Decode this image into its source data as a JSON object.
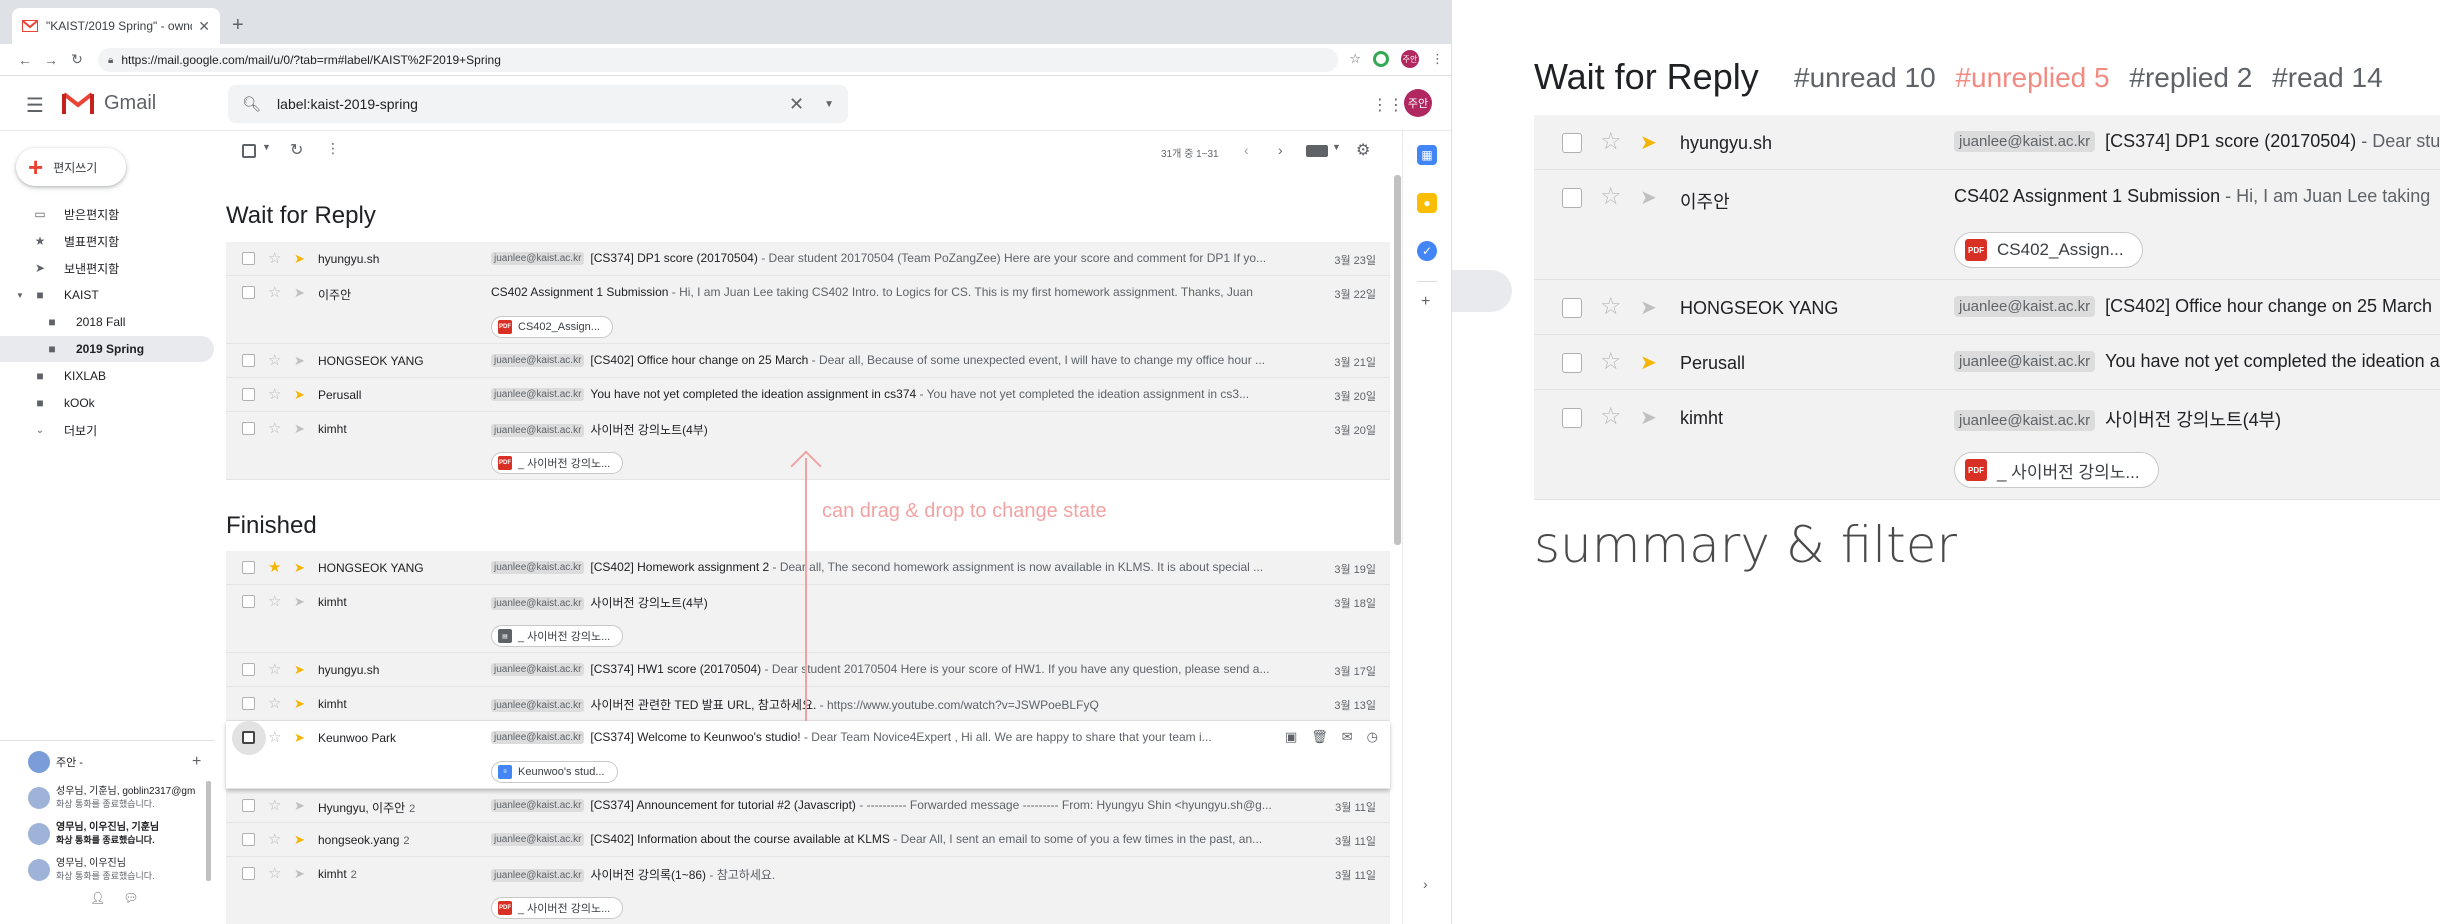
{
  "browser": {
    "tab_title": "\"KAIST/2019 Spring\" - ownde",
    "url": "https://mail.google.com/mail/u/0/?tab=rm#label/KAIST%2F2019+Spring",
    "avatar_text": "주안"
  },
  "gmail": {
    "app_name": "Gmail",
    "search_value": "label:kaist-2019-spring",
    "avatar_text": "주안",
    "compose_label": "편지쓰기",
    "nav": [
      {
        "label": "받은편지함",
        "icon": "inbox-icon"
      },
      {
        "label": "별표편지함",
        "icon": "star-icon"
      },
      {
        "label": "보낸편지함",
        "icon": "send-icon"
      },
      {
        "label": "KAIST",
        "icon": "label-icon"
      },
      {
        "label": "2018 Fall",
        "icon": "label-icon"
      },
      {
        "label": "2019 Spring",
        "icon": "label-icon"
      },
      {
        "label": "KIXLAB",
        "icon": "label-icon"
      },
      {
        "label": "kOOk",
        "icon": "label-icon"
      },
      {
        "label": "더보기",
        "icon": "chevron-down-icon"
      }
    ],
    "active_nav": "2019 Spring",
    "toolbar": {
      "count_text": "31개 중 1~31"
    },
    "hangouts": {
      "user_label": "주안 -",
      "conversations": [
        {
          "title": "성우님, 기훈님, goblin2317@gm",
          "sub": "화상 통화를 종료했습니다.",
          "bold": false
        },
        {
          "title": "영무님, 이우진님, 기훈님",
          "sub": "화상 통화를 종료했습니다.",
          "bold": true
        },
        {
          "title": "영무님, 이우진님",
          "sub": "화상 통화를 종료했습니다.",
          "bold": false
        }
      ]
    }
  },
  "sections": [
    {
      "title": "Wait for Reply",
      "rows": [
        {
          "sender": "hyungyu.sh",
          "count": "",
          "label": "juanlee@kaist.ac.kr",
          "subject": "[CS374] DP1 score (20170504)",
          "snippet": " - Dear student 20170504 (Team PoZangZee) Here are your score and comment for DP1 If yo...",
          "date": "3월 23일",
          "starred": false,
          "important": true,
          "attachment": null
        },
        {
          "sender": "이주안",
          "count": "",
          "label": "",
          "subject": "CS402 Assignment 1 Submission",
          "snippet": " - Hi, I am Juan Lee taking CS402 Intro. to Logics for CS. This is my first homework assignment. Thanks, Juan",
          "date": "3월 22일",
          "starred": false,
          "important": false,
          "attachment": {
            "name": "CS402_Assign...",
            "type": "pdf"
          }
        },
        {
          "sender": "HONGSEOK YANG",
          "count": "",
          "label": "juanlee@kaist.ac.kr",
          "subject": "[CS402] Office hour change on 25 March",
          "snippet": " - Dear all, Because of some unexpected event, I will have to change my office hour ...",
          "date": "3월 21일",
          "starred": false,
          "important": false,
          "attachment": null
        },
        {
          "sender": "Perusall",
          "count": "",
          "label": "juanlee@kaist.ac.kr",
          "subject": "You have not yet completed the ideation assignment in cs374",
          "snippet": " - You have not yet completed the ideation assignment in cs3...",
          "date": "3월 20일",
          "starred": false,
          "important": true,
          "attachment": null
        },
        {
          "sender": "kimht",
          "count": "",
          "label": "juanlee@kaist.ac.kr",
          "subject": "사이버전 강의노트(4부)",
          "snippet": "",
          "date": "3월 20일",
          "starred": false,
          "important": false,
          "attachment": {
            "name": "_ 사이버전 강의노...",
            "type": "pdf"
          }
        }
      ]
    },
    {
      "title": "Finished",
      "rows": [
        {
          "sender": "HONGSEOK YANG",
          "count": "",
          "label": "juanlee@kaist.ac.kr",
          "subject": "[CS402] Homework assignment 2",
          "snippet": " - Dear all, The second homework assignment is now available in KLMS. It is about special ...",
          "date": "3월 19일",
          "starred": true,
          "important": true,
          "attachment": null
        },
        {
          "sender": "kimht",
          "count": "",
          "label": "juanlee@kaist.ac.kr",
          "subject": "사이버전 강의노트(4부)",
          "snippet": "",
          "date": "3월 18일",
          "starred": false,
          "important": false,
          "attachment": {
            "name": "_ 사이버전 강의노...",
            "type": "zip"
          }
        },
        {
          "sender": "hyungyu.sh",
          "count": "",
          "label": "juanlee@kaist.ac.kr",
          "subject": "[CS374] HW1 score (20170504)",
          "snippet": " - Dear student 20170504 Here is your score of HW1. If you have any question, please send a...",
          "date": "3월 17일",
          "starred": false,
          "important": true,
          "attachment": null
        },
        {
          "sender": "kimht",
          "count": "",
          "label": "juanlee@kaist.ac.kr",
          "subject": "사이버전 관련한 TED 발표 URL, 참고하세요.",
          "snippet": " - https://www.youtube.com/watch?v=JSWPoeBLFyQ",
          "date": "3월 13일",
          "starred": false,
          "important": true,
          "attachment": null
        },
        {
          "sender": "Keunwoo Park",
          "count": "",
          "label": "juanlee@kaist.ac.kr",
          "subject": "[CS374] Welcome to Keunwoo's studio!",
          "snippet": " - Dear Team Novice4Expert , Hi all. We are happy to share that your team i...",
          "date": "",
          "starred": false,
          "important": true,
          "attachment": {
            "name": "Keunwoo's stud...",
            "type": "doc"
          },
          "hovered": true
        },
        {
          "sender": "Hyungyu, 이주안",
          "count": "2",
          "label": "juanlee@kaist.ac.kr",
          "subject": "[CS374] Announcement for tutorial #2 (Javascript)",
          "snippet": " - ---------- Forwarded message --------- From: Hyungyu Shin <hyungyu.sh@g...",
          "date": "3월 11일",
          "starred": false,
          "important": false,
          "attachment": null
        },
        {
          "sender": "hongseok.yang",
          "count": "2",
          "label": "juanlee@kaist.ac.kr",
          "subject": "[CS402] Information about the course available at KLMS",
          "snippet": " - Dear All, I sent an email to some of you a few times in the past, an...",
          "date": "3월 11일",
          "starred": false,
          "important": true,
          "attachment": null
        },
        {
          "sender": "kimht",
          "count": "2",
          "label": "juanlee@kaist.ac.kr",
          "subject": "사이버전 강의록(1~86)",
          "snippet": " - 참고하세요.",
          "date": "3월 11일",
          "starred": false,
          "important": false,
          "attachment": {
            "name": "_ 사이버전 강의노...",
            "type": "pdf"
          }
        }
      ]
    }
  ],
  "annotation": {
    "drag_text": "can drag & drop to change state"
  },
  "zoom": {
    "title": "Wait for Reply",
    "tags": [
      {
        "text": "#unread 10",
        "highlight": false
      },
      {
        "text": "#unreplied 5",
        "highlight": true
      },
      {
        "text": "#replied 2",
        "highlight": false
      },
      {
        "text": "#read 14",
        "highlight": false
      }
    ],
    "rows": [
      {
        "sender": "hyungyu.sh",
        "label": "juanlee@kaist.ac.kr",
        "subject": "[CS374] DP1 score (20170504)",
        "snippet": " - Dear student",
        "important": true,
        "attachment": null
      },
      {
        "sender": "이주안",
        "label": "",
        "subject": "CS402 Assignment 1 Submission",
        "snippet": " - Hi, I am Juan Lee taking",
        "important": false,
        "attachment": "CS402_Assign..."
      },
      {
        "sender": "HONGSEOK YANG",
        "label": "juanlee@kaist.ac.kr",
        "subject": "[CS402] Office hour change on 25 March",
        "snippet": "",
        "important": false,
        "attachment": null
      },
      {
        "sender": "Perusall",
        "label": "juanlee@kaist.ac.kr",
        "subject": "You have not yet completed the ideation assignment",
        "snippet": "",
        "important": true,
        "attachment": null
      },
      {
        "sender": "kimht",
        "label": "juanlee@kaist.ac.kr",
        "subject": "사이버전 강의노트(4부)",
        "snippet": "",
        "important": false,
        "attachment": "_ 사이버전 강의노..."
      }
    ],
    "caption": "summary & filter"
  }
}
